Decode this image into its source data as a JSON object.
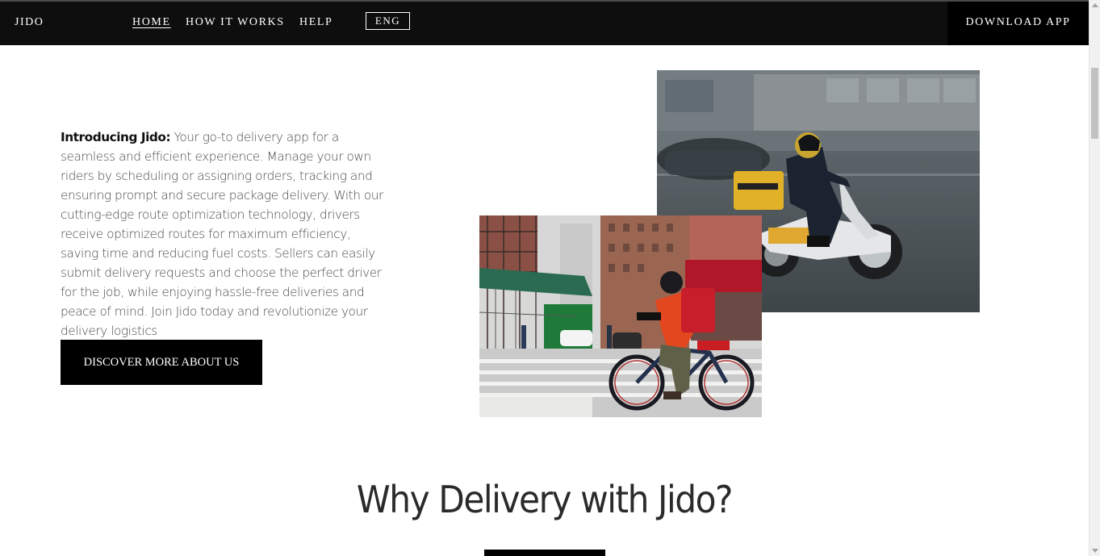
{
  "nav": {
    "brand": "JIDO",
    "items": [
      {
        "label": "HOME",
        "active": true
      },
      {
        "label": "HOW IT WORKS",
        "active": false
      },
      {
        "label": "HELP",
        "active": false
      }
    ],
    "language": "ENG",
    "download_label": "DOWNLOAD APP"
  },
  "intro": {
    "lead": "Introducing Jido:",
    "body": " Your go-to delivery app for a seamless and efficient experience. Manage your own riders by scheduling or assigning orders, tracking and ensuring prompt and secure package delivery. With our cutting-edge route optimization technology, drivers receive optimized routes for maximum efficiency, saving time and reducing fuel costs. Sellers can easily submit delivery requests and choose the perfect driver for the job, while enjoying hassle-free deliveries and peace of mind. Join Jido today and revolutionize your delivery logistics"
  },
  "cta": {
    "discover_label": "DISCOVER MORE ABOUT US"
  },
  "section": {
    "title": "Why Delivery with Jido?"
  },
  "colors": {
    "nav_bg": "#0e0e0e",
    "button_bg": "#000000",
    "text": "#4a4a4a"
  }
}
